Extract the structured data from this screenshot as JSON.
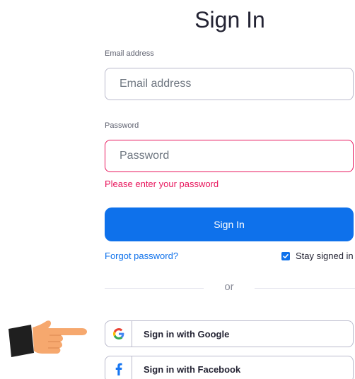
{
  "title": "Sign In",
  "email": {
    "label": "Email address",
    "placeholder": "Email address"
  },
  "password": {
    "label": "Password",
    "placeholder": "Password",
    "error": "Please enter your password"
  },
  "signin_button": "Sign In",
  "forgot_link": "Forgot password?",
  "stay_signed_in": {
    "label": "Stay signed in",
    "checked": true
  },
  "divider_text": "or",
  "social": {
    "google": {
      "label": "Sign in with Google",
      "icon": "google-icon"
    },
    "facebook": {
      "label": "Sign in with Facebook",
      "icon": "facebook-icon"
    }
  },
  "pointer": {
    "icon": "pointing-hand-icon"
  },
  "colors": {
    "primary": "#0e71eb",
    "error": "#e8175d",
    "border": "#babacc",
    "text": "#232333"
  }
}
